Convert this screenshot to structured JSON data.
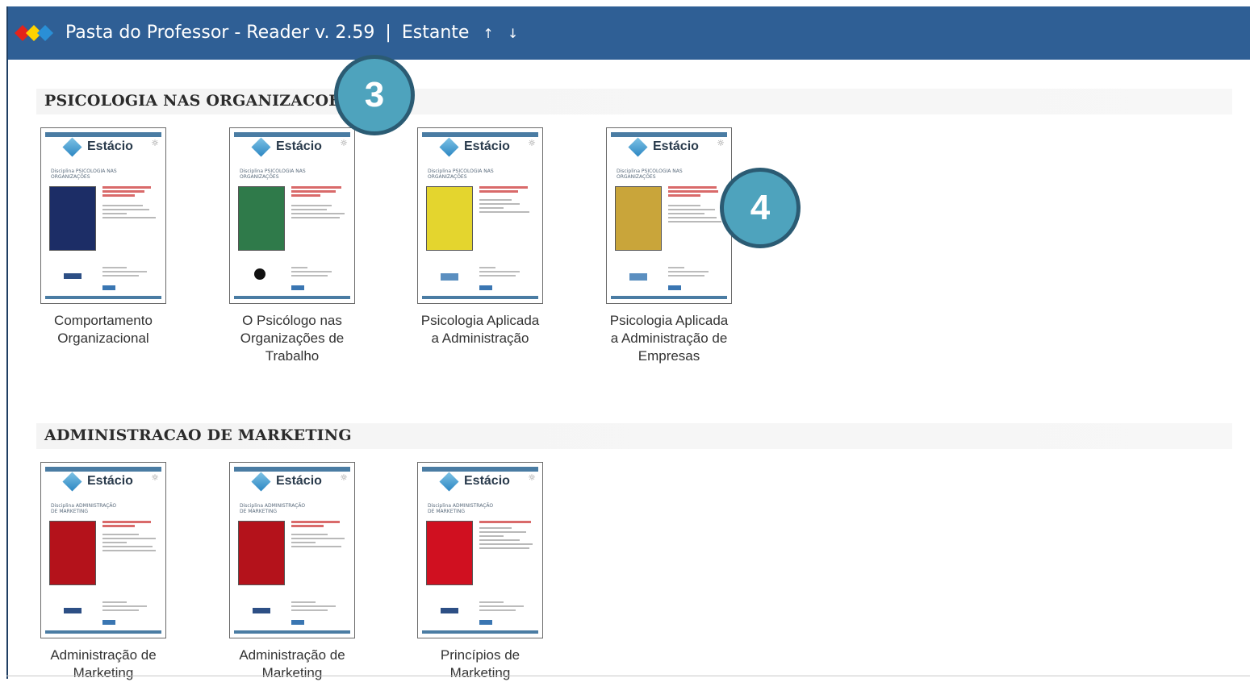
{
  "window": {
    "app_name": "Pasta do Professor - Reader v. 2.59",
    "separator": "|",
    "view": "Estante",
    "sort_up": "↑",
    "sort_down": "↓"
  },
  "sections": [
    {
      "title": "PSICOLOGIA NAS ORGANIZACOES",
      "books": [
        {
          "label": "Comportamento Organizacional",
          "brand": "Estácio",
          "discipline": "Disciplina PSICOLOGIA NAS ORGANIZAÇÕES",
          "cover_color": "#1c2d66"
        },
        {
          "label": "O Psicólogo nas Organizações de Trabalho",
          "brand": "Estácio",
          "discipline": "Disciplina PSICOLOGIA NAS ORGANIZAÇÕES",
          "cover_color": "#2f7a4a"
        },
        {
          "label": "Psicologia Aplicada a Administração",
          "brand": "Estácio",
          "discipline": "Disciplina PSICOLOGIA NAS ORGANIZAÇÕES",
          "cover_color": "#e4d52e"
        },
        {
          "label": "Psicologia Aplicada a Administração de Empresas",
          "brand": "Estácio",
          "discipline": "Disciplina PSICOLOGIA NAS ORGANIZAÇÕES",
          "cover_color": "#c9a53a"
        }
      ]
    },
    {
      "title": "ADMINISTRACAO DE MARKETING",
      "books": [
        {
          "label": "Administração de Marketing",
          "brand": "Estácio",
          "discipline": "Disciplina ADMINISTRAÇÃO DE MARKETING",
          "cover_color": "#b4121b"
        },
        {
          "label": "Administração de Marketing",
          "brand": "Estácio",
          "discipline": "Disciplina ADMINISTRAÇÃO DE MARKETING",
          "cover_color": "#b4121b"
        },
        {
          "label": "Princípios de Marketing",
          "brand": "Estácio",
          "discipline": "Disciplina ADMINISTRAÇÃO DE MARKETING",
          "cover_color": "#d01020"
        }
      ]
    }
  ],
  "badges": [
    "3",
    "4"
  ],
  "colors": {
    "titlebar": "#2f5f95",
    "badge_fill": "#4ea3bd",
    "badge_border": "#2b5b73"
  }
}
